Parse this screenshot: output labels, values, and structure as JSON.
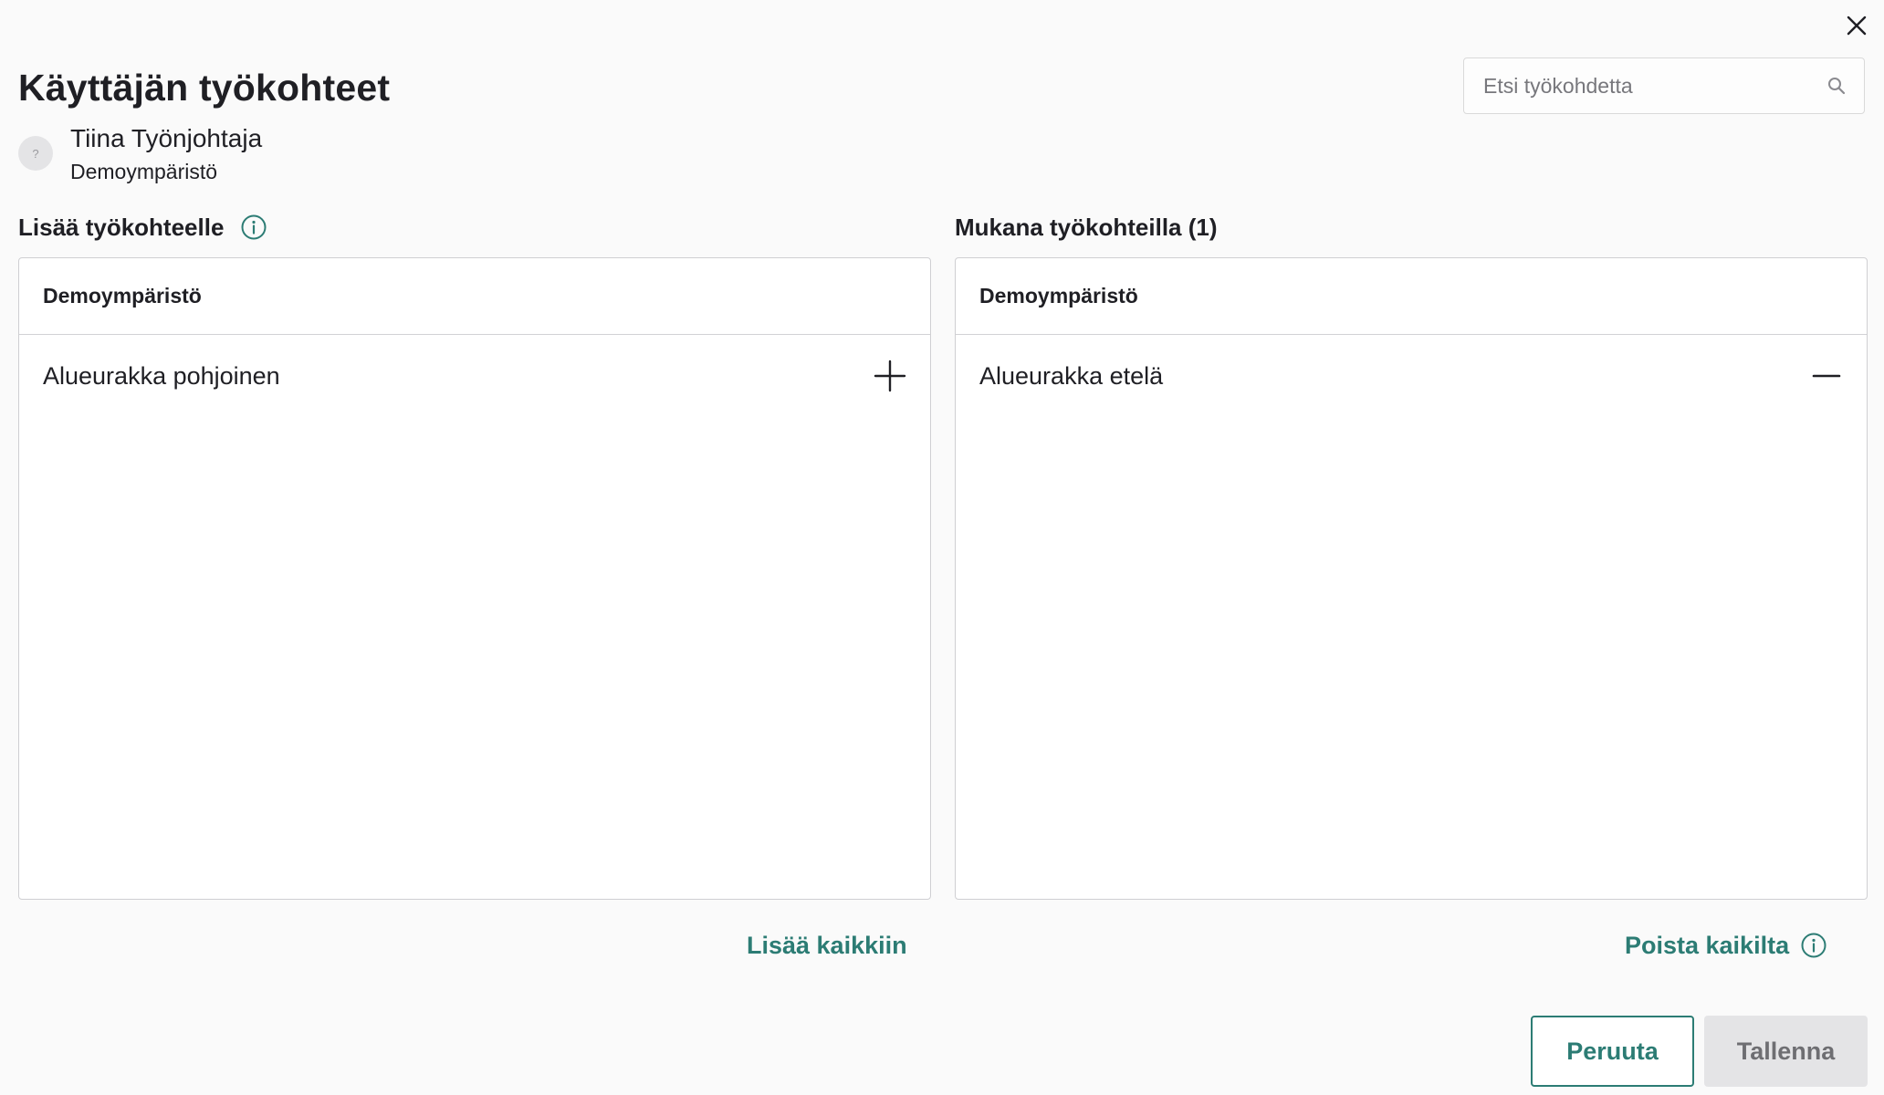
{
  "dialog": {
    "title": "Käyttäjän työkohteet",
    "close_icon": "close-icon"
  },
  "search": {
    "placeholder": "Etsi työkohdetta",
    "value": "",
    "icon": "search-icon"
  },
  "user": {
    "avatar_text": "?",
    "name": "Tiina Työnjohtaja",
    "organization": "Demoympäristö"
  },
  "available": {
    "heading": "Lisää työkohteelle",
    "info_icon": "info-icon",
    "group_header": "Demoympäristö",
    "items": [
      {
        "label": "Alueurakka pohjoinen",
        "action_icon": "plus-icon"
      }
    ],
    "bulk_action_label": "Lisää kaikkiin"
  },
  "assigned": {
    "heading": "Mukana työkohteilla (1)",
    "group_header": "Demoympäristö",
    "items": [
      {
        "label": "Alueurakka etelä",
        "action_icon": "minus-icon"
      }
    ],
    "bulk_action_label": "Poista kaikilta",
    "info_icon": "info-icon"
  },
  "footer": {
    "cancel_label": "Peruuta",
    "save_label": "Tallenna",
    "save_disabled": true
  },
  "colors": {
    "accent": "#2c7c74",
    "text": "#1f1f24",
    "border": "#cfcfd2",
    "background": "#fafafa",
    "disabled_bg": "#e4e4e6"
  }
}
